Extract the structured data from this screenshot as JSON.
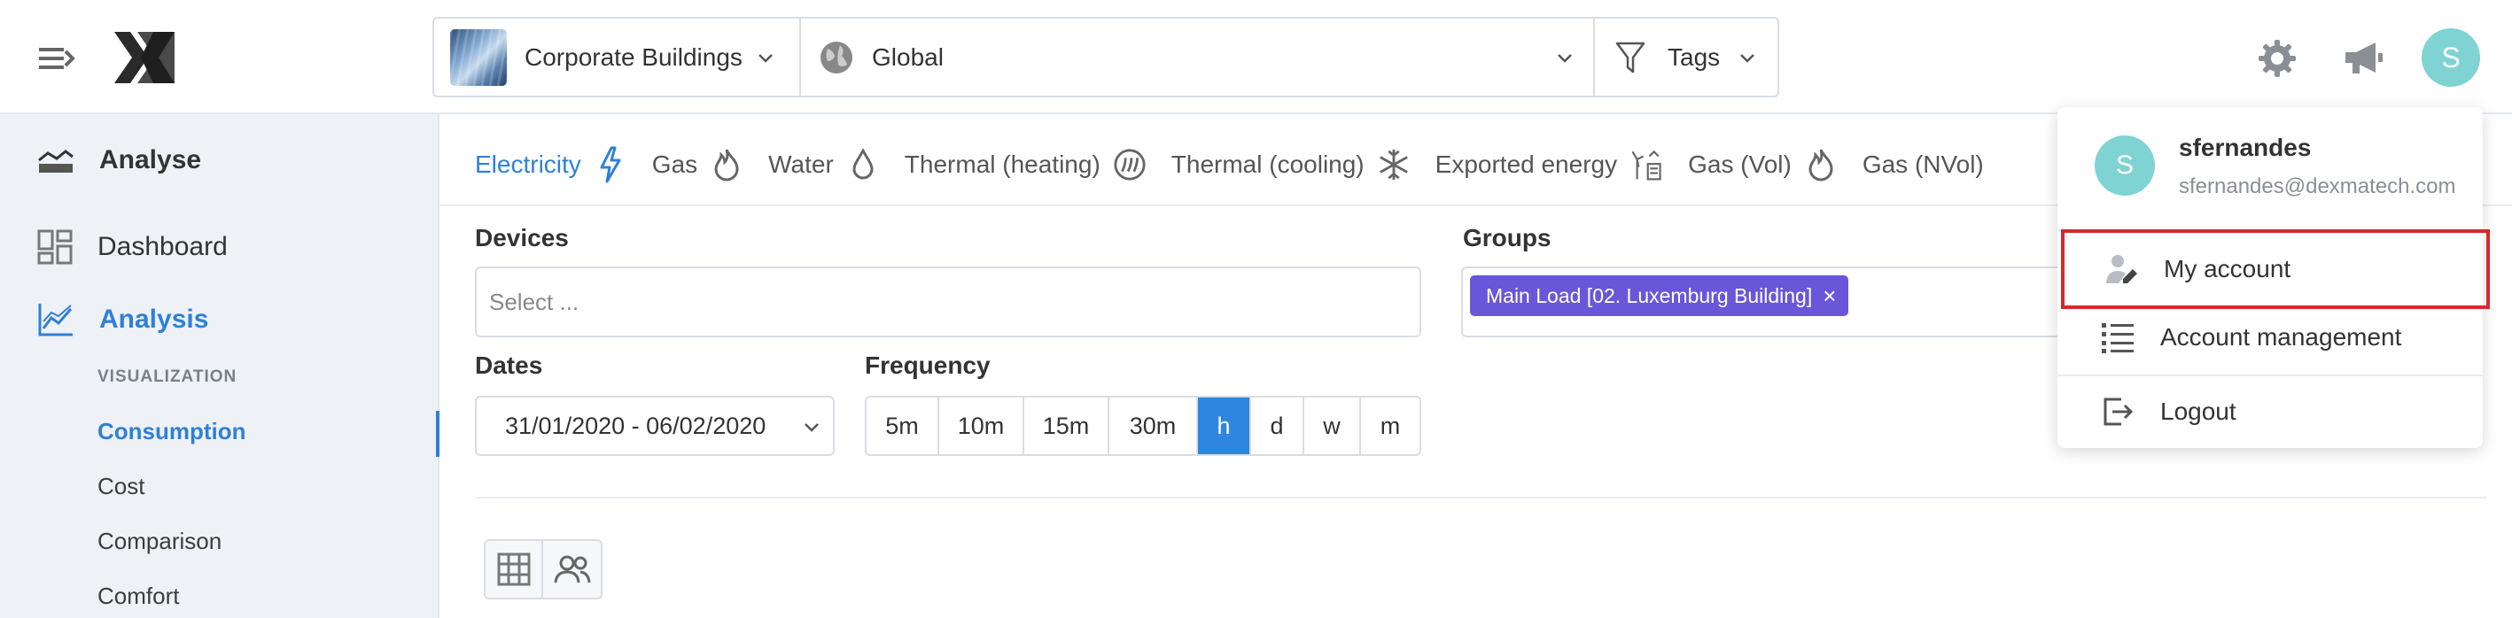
{
  "header": {
    "building_label": "Corporate Buildings",
    "location_label": "Global",
    "tags_label": "Tags",
    "avatar_initial": "S",
    "icons": [
      "menu-collapse-icon",
      "logo-icon",
      "globe-icon",
      "filter-icon",
      "gear-icon",
      "megaphone-icon"
    ]
  },
  "sidebar": {
    "analyse_label": "Analyse",
    "dashboard_label": "Dashboard",
    "analysis_label": "Analysis",
    "visualization_caption": "VISUALIZATION",
    "items": [
      {
        "label": "Consumption"
      },
      {
        "label": "Cost"
      },
      {
        "label": "Comparison"
      },
      {
        "label": "Comfort"
      }
    ]
  },
  "energy_tabs": [
    {
      "label": "Electricity",
      "icon": "lightning-icon",
      "active": true
    },
    {
      "label": "Gas",
      "icon": "flame-icon"
    },
    {
      "label": "Water",
      "icon": "droplet-icon"
    },
    {
      "label": "Thermal (heating)",
      "icon": "heating-icon"
    },
    {
      "label": "Thermal (cooling)",
      "icon": "snowflake-icon"
    },
    {
      "label": "Exported energy",
      "icon": "exported-energy-icon"
    },
    {
      "label": "Gas (Vol)",
      "icon": "flame-icon"
    },
    {
      "label": "Gas (NVol)",
      "icon": "flame-icon"
    }
  ],
  "filters": {
    "devices_label": "Devices",
    "devices_placeholder": "Select ...",
    "groups_label": "Groups",
    "group_chip": "Main Load [02. Luxemburg Building]",
    "dates_label": "Dates",
    "date_range": "31/01/2020 - 06/02/2020",
    "frequency_label": "Frequency",
    "frequencies": [
      {
        "label": "5m"
      },
      {
        "label": "10m"
      },
      {
        "label": "15m"
      },
      {
        "label": "30m"
      },
      {
        "label": "h",
        "active": true
      },
      {
        "label": "d"
      },
      {
        "label": "w"
      },
      {
        "label": "m"
      }
    ]
  },
  "user_menu": {
    "username": "sfernandes",
    "email": "sfernandes@dexmatech.com",
    "avatar_initial": "S",
    "items": [
      {
        "label": "My account",
        "icon": "user-edit-icon",
        "highlighted": true
      },
      {
        "label": "Account management",
        "icon": "list-icon"
      },
      {
        "label": "Logout",
        "icon": "logout-icon"
      }
    ]
  },
  "colors": {
    "accent": "#2f80d8",
    "chip": "#6a56d8",
    "avatar": "#7fd3d3",
    "highlight_border": "#d42a2a",
    "sidebar_bg": "#eef1f5"
  }
}
